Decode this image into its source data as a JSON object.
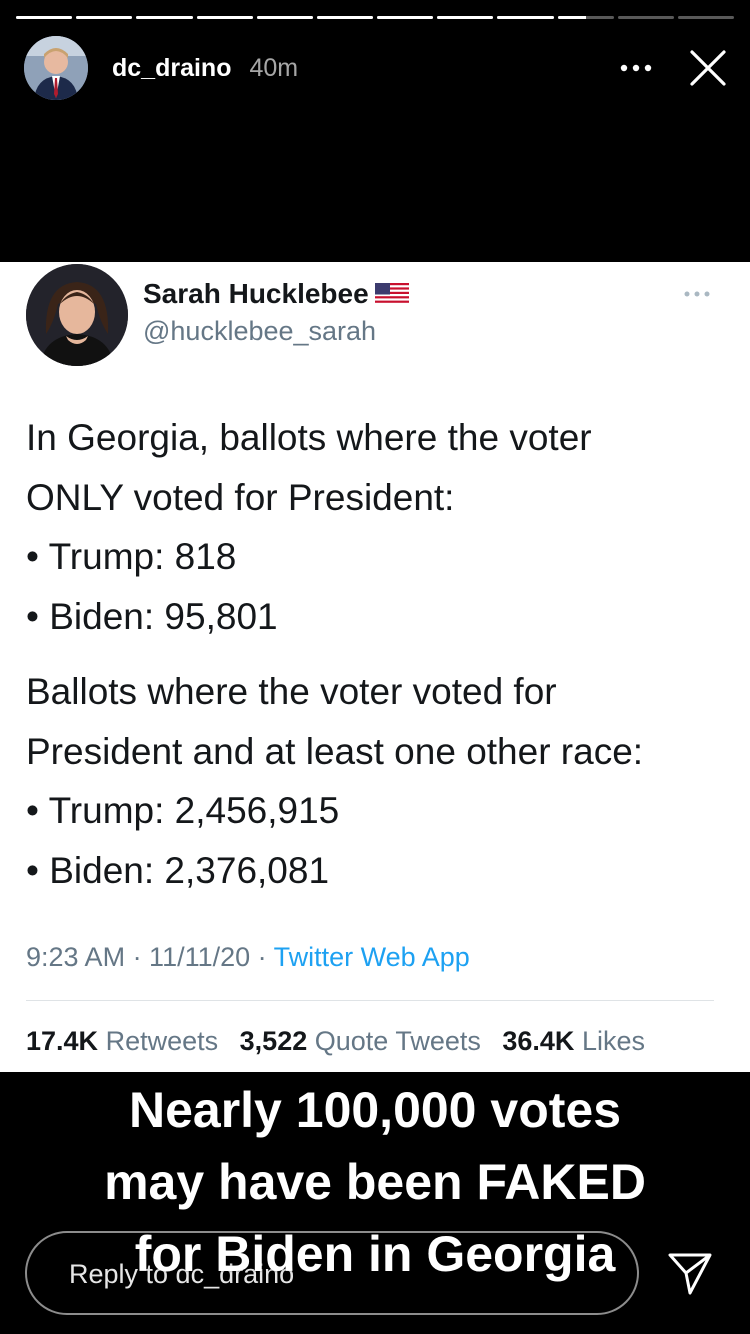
{
  "story": {
    "segments": [
      1,
      1,
      1,
      1,
      1,
      1,
      1,
      1,
      1,
      0.5,
      0,
      0
    ],
    "username": "dc_draino",
    "time": "40m"
  },
  "tweet": {
    "name": "Sarah Hucklebee",
    "flag_icon": "us-flag-icon",
    "handle": "@hucklebee_sarah",
    "body": [
      "In Georgia, ballots where the voter",
      "ONLY voted for President:",
      "• Trump: 818",
      "• Biden: 95,801",
      "",
      "Ballots where the voter voted for",
      "President and at least one other race:",
      "• Trump: 2,456,915",
      "• Biden: 2,376,081"
    ],
    "meta": {
      "time": "9:23 AM · 11/11/20 · ",
      "app": "Twitter Web App"
    },
    "stats": {
      "retweets_count": "17.4K",
      "retweets_label": "Retweets",
      "quotes_count": "3,522",
      "quotes_label": "Quote Tweets",
      "likes_count": "36.4K",
      "likes_label": "Likes"
    }
  },
  "caption": {
    "line1": "Nearly 100,000 votes",
    "line2": "may have been FAKED",
    "line3": "for Biden in Georgia"
  },
  "reply": {
    "placeholder": "Reply to dc_draino"
  }
}
